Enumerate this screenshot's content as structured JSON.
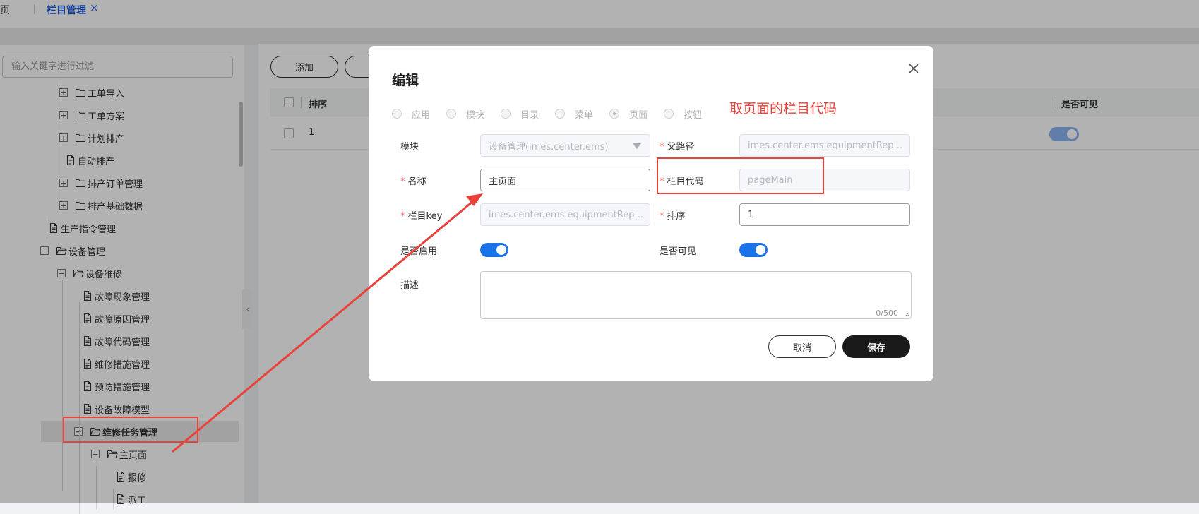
{
  "tabs": {
    "home": "页",
    "active": "栏目管理",
    "close": "×"
  },
  "sidebar": {
    "filter_placeholder": "输入关键字进行过滤",
    "collapse": "‹",
    "tree": [
      {
        "label": "工单导入",
        "toggle": "+",
        "icon": "folder-icon"
      },
      {
        "label": "工单方案",
        "toggle": "+",
        "icon": "folder-icon"
      },
      {
        "label": "计划排产",
        "toggle": "+",
        "icon": "folder-icon"
      },
      {
        "label": "自动排产",
        "icon": "file-icon"
      },
      {
        "label": "排产订单管理",
        "toggle": "+",
        "icon": "folder-icon"
      },
      {
        "label": "排产基础数据",
        "toggle": "+",
        "icon": "folder-icon"
      },
      {
        "label": "生产指令管理",
        "icon": "file-icon"
      },
      {
        "label": "设备管理",
        "toggle": "−",
        "icon": "folder-open-icon"
      },
      {
        "label": "设备维修",
        "toggle": "−",
        "icon": "folder-open-icon"
      },
      {
        "label": "故障现象管理",
        "icon": "file-icon"
      },
      {
        "label": "故障原因管理",
        "icon": "file-icon"
      },
      {
        "label": "故障代码管理",
        "icon": "file-icon"
      },
      {
        "label": "维修措施管理",
        "icon": "file-icon"
      },
      {
        "label": "预防措施管理",
        "icon": "file-icon"
      },
      {
        "label": "设备故障模型",
        "icon": "file-icon"
      },
      {
        "label": "维修任务管理",
        "toggle": "−",
        "icon": "folder-open-icon"
      },
      {
        "label": "主页面",
        "toggle": "−",
        "icon": "folder-open-icon"
      },
      {
        "label": "报修",
        "icon": "file-icon"
      },
      {
        "label": "派工",
        "icon": "file-icon"
      }
    ]
  },
  "toolbar": {
    "add_label": "添加"
  },
  "table": {
    "headers": {
      "sort": "排序",
      "visible": "是否可见"
    },
    "rows": [
      {
        "sort": "1",
        "visible": true
      }
    ]
  },
  "modal": {
    "title": "编辑",
    "types": [
      {
        "label": "应用",
        "checked": false
      },
      {
        "label": "模块",
        "checked": false
      },
      {
        "label": "目录",
        "checked": false
      },
      {
        "label": "菜单",
        "checked": false
      },
      {
        "label": "页面",
        "checked": true
      },
      {
        "label": "按钮",
        "checked": false
      }
    ],
    "fields": {
      "module": {
        "label": "模块",
        "value": "设备管理(imes.center.ems)"
      },
      "parent_path": {
        "label": "父路径",
        "value": "imes.center.ems.equipmentRep..."
      },
      "name": {
        "label": "名称",
        "value": "主页面"
      },
      "column_code": {
        "label": "栏目代码",
        "value": "pageMain"
      },
      "column_key": {
        "label": "栏目key",
        "value": "imes.center.ems.equipmentRep..."
      },
      "sort": {
        "label": "排序",
        "value": "1"
      },
      "enabled": {
        "label": "是否启用",
        "value": true
      },
      "visible": {
        "label": "是否可见",
        "value": true
      },
      "description": {
        "label": "描述",
        "value": "",
        "counter": "0/500"
      }
    },
    "buttons": {
      "cancel": "取消",
      "save": "保存"
    }
  },
  "annotation": {
    "text": "取页面的栏目代码",
    "color": "#e8423a"
  },
  "colors": {
    "accent": "#1a73e8",
    "tab_active": "#1a5bd6",
    "annotation": "#e8423a",
    "primary_button": "#1a1a1a"
  }
}
